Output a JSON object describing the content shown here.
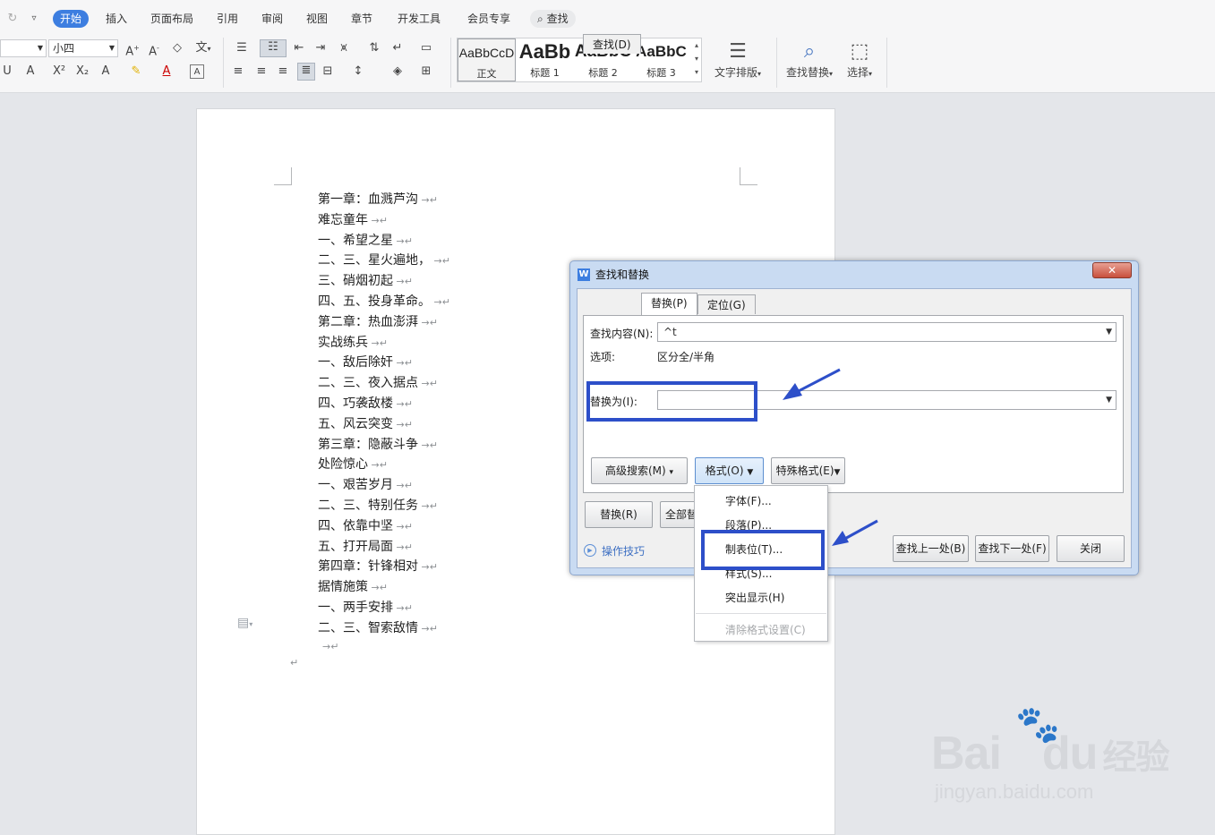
{
  "ribbon": {
    "tabs": [
      "开始",
      "插入",
      "页面布局",
      "引用",
      "审阅",
      "视图",
      "章节",
      "开发工具",
      "会员专享"
    ],
    "search_label": "查找",
    "font_size": "小四",
    "styles": [
      {
        "preview": "AaBbCcD",
        "name": "正文"
      },
      {
        "preview": "AaBb",
        "name": "标题 1"
      },
      {
        "preview": "AaBbC",
        "name": "标题 2"
      },
      {
        "preview": "AaBbC",
        "name": "标题 3"
      }
    ],
    "text_layout_label": "文字排版",
    "find_replace_label": "查找替换",
    "select_label": "选择"
  },
  "document": {
    "lines": [
      {
        "text": "第一章：血溅芦沟",
        "tab": true
      },
      {
        "text": "难忘童年",
        "tab": true
      },
      {
        "text": "一、希望之星",
        "tab": true
      },
      {
        "text": "二、三、星火遍地，",
        "tab": true
      },
      {
        "text": "三、硝烟初起",
        "tab": true
      },
      {
        "text": "四、五、投身革命。",
        "tab": true
      },
      {
        "text": "第二章：热血澎湃",
        "tab": true
      },
      {
        "text": "实战练兵",
        "tab": true
      },
      {
        "text": "一、敌后除奸",
        "tab": true
      },
      {
        "text": "二、三、夜入据点",
        "tab": true
      },
      {
        "text": "四、巧袭敌楼",
        "tab": true
      },
      {
        "text": "五、风云突变",
        "tab": true
      },
      {
        "text": "第三章：隐蔽斗争",
        "tab": true
      },
      {
        "text": "处险惊心",
        "tab": true
      },
      {
        "text": "一、艰苦岁月",
        "tab": true
      },
      {
        "text": "二、三、特别任务",
        "tab": true
      },
      {
        "text": "四、依靠中坚",
        "tab": true
      },
      {
        "text": "五、打开局面",
        "tab": true
      },
      {
        "text": "第四章：针锋相对",
        "tab": true
      },
      {
        "text": "据情施策",
        "tab": true
      },
      {
        "text": "一、两手安排",
        "tab": true
      },
      {
        "text": "二、三、智索敌情",
        "tab": true
      },
      {
        "text": "",
        "tab": true
      }
    ]
  },
  "dialog": {
    "title": "查找和替换",
    "tabs": [
      "查找(D)",
      "替换(P)",
      "定位(G)"
    ],
    "find_label": "查找内容(N):",
    "find_value": "^t",
    "options_label": "选项:",
    "options_value": "区分全/半角",
    "replace_label": "替换为(I):",
    "replace_value": "",
    "advanced_btn": "高级搜索(M)",
    "format_btn": "格式(O)",
    "special_btn": "特殊格式(E)",
    "replace_btn": "替换(R)",
    "replace_all_btn": "全部替换(A)",
    "tips_link": "操作技巧",
    "find_prev_btn": "查找上一处(B)",
    "find_next_btn": "查找下一处(F)",
    "close_btn": "关闭"
  },
  "format_menu": {
    "items": [
      "字体(F)...",
      "段落(P)...",
      "制表位(T)...",
      "样式(S)...",
      "突出显示(H)"
    ],
    "disabled_item": "清除格式设置(C)"
  },
  "watermark": {
    "brand": "Bai",
    "brand2": "du",
    "cn": "经验",
    "url": "jingyan.baidu.com"
  },
  "colors": {
    "accent": "#3d7ee0",
    "highlight": "#2d4fc9"
  }
}
